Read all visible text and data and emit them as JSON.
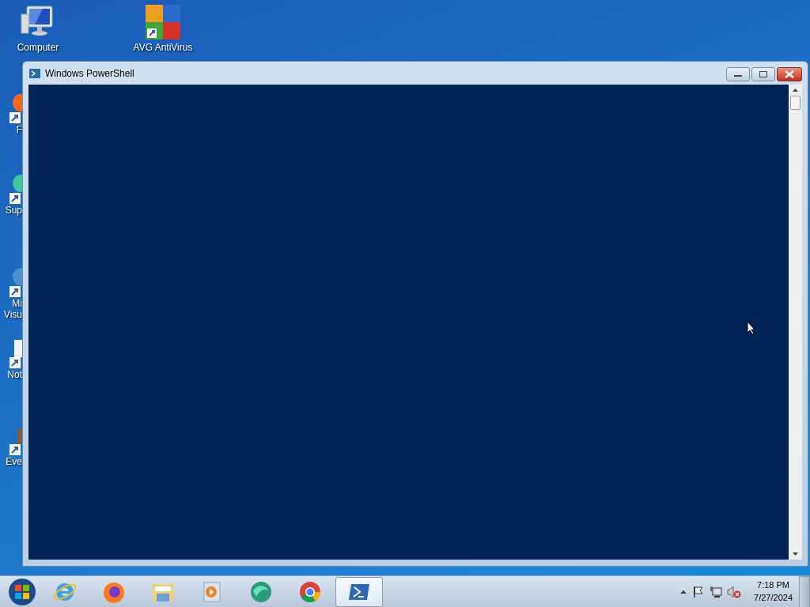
{
  "desktop_icons": [
    {
      "kind": "computer",
      "label": "Computer"
    },
    {
      "kind": "avg",
      "label": "AVG AntiVirus"
    }
  ],
  "partial_icons": [
    {
      "kind": "firefox",
      "lines": [
        "F"
      ]
    },
    {
      "kind": "support",
      "lines": [
        "Sup"
      ]
    },
    {
      "kind": "edge",
      "lines": [
        "Mi",
        "Visu"
      ]
    },
    {
      "kind": "notepad",
      "lines": [
        "Not"
      ]
    },
    {
      "kind": "event",
      "lines": [
        "Eve"
      ]
    }
  ],
  "window": {
    "title": "Windows PowerShell"
  },
  "taskbar": {
    "apps": [
      {
        "kind": "ie",
        "selected": false
      },
      {
        "kind": "firefox",
        "selected": false
      },
      {
        "kind": "explorer",
        "selected": false
      },
      {
        "kind": "media",
        "selected": false
      },
      {
        "kind": "support",
        "selected": false
      },
      {
        "kind": "chrome",
        "selected": false
      },
      {
        "kind": "powershell",
        "selected": true
      }
    ],
    "clock": {
      "time": "7:18 PM",
      "date": "7/27/2024"
    }
  }
}
